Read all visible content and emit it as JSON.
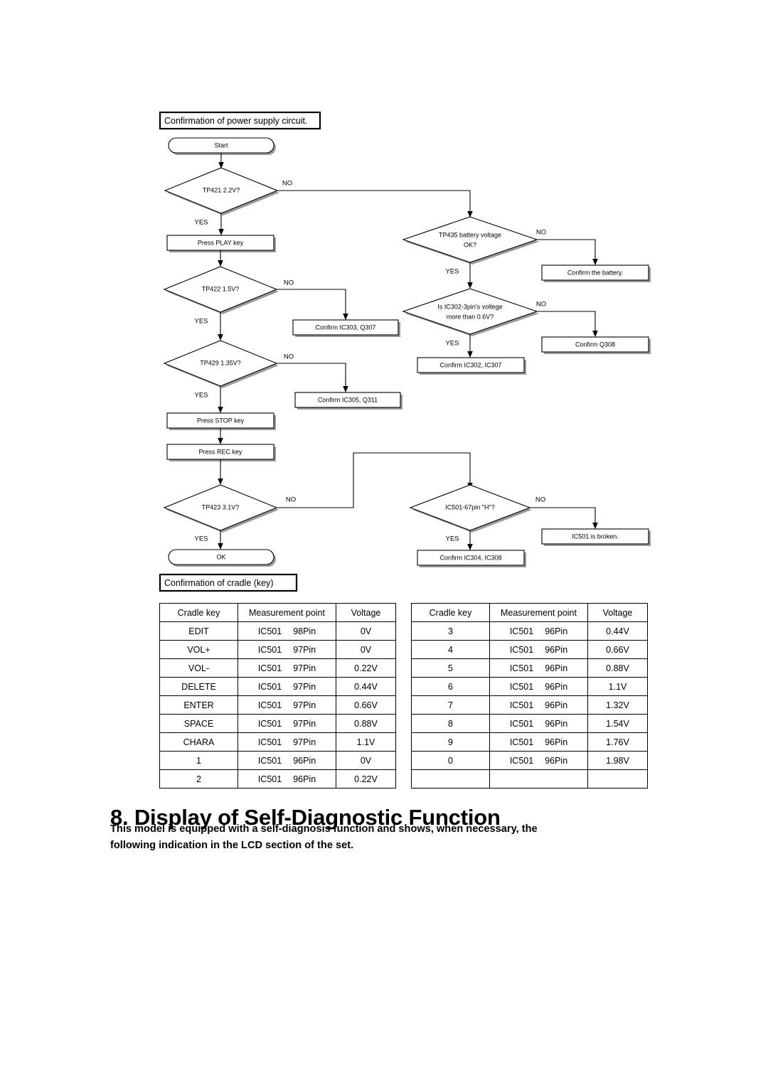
{
  "page": {
    "background_color": "#ffffff",
    "ink_color": "#000000",
    "shadow_color": "#9a9a9a"
  },
  "flowchart": {
    "banner_top": "Confirmation of power supply circuit.",
    "banner_bottom": "Confirmation of cradle (key)",
    "terminals": {
      "start": "Start",
      "ok": "OK"
    },
    "decisions": {
      "tp421": "TP421 2.2V?",
      "tp422": "TP422 1.5V?",
      "tp429": "TP429 1.35V?",
      "tp423": "TP423 3.1V?",
      "tp435_line1": "TP435 battery voltage",
      "tp435_line2": "OK?",
      "ic302_line1": "Is IC302-3pin's voltege",
      "ic302_line2": "more than 0.6V?",
      "ic501_67pin": "IC501-67pin \"H\"?"
    },
    "processes": {
      "press_play": "Press PLAY key",
      "press_stop": "Press STOP key",
      "press_rec": "Press REC key",
      "confirm_ic303_q307": "Confirm IC303, Q307",
      "confirm_ic305_q311": "Confirm IC305, Q311",
      "confirm_battery": "Confirm the battery.",
      "confirm_q308": "Confirm Q308",
      "confirm_ic302_ic307": "Confirm IC302, IC307",
      "confirm_ic304_ic308": "Confirm IC304, IC308",
      "ic501_broken": "IC501 is broken."
    },
    "branch_labels": {
      "yes": "YES",
      "no": "NO"
    }
  },
  "tables": {
    "headers": [
      "Cradle key",
      "Measurement point",
      "Voltage"
    ],
    "left_rows": [
      {
        "key": "EDIT",
        "ic": "IC501",
        "pin": "98Pin",
        "voltage": "0V"
      },
      {
        "key": "VOL+",
        "ic": "IC501",
        "pin": "97Pin",
        "voltage": "0V"
      },
      {
        "key": "VOL-",
        "ic": "IC501",
        "pin": "97Pin",
        "voltage": "0.22V"
      },
      {
        "key": "DELETE",
        "ic": "IC501",
        "pin": "97Pin",
        "voltage": "0.44V"
      },
      {
        "key": "ENTER",
        "ic": "IC501",
        "pin": "97Pin",
        "voltage": "0.66V"
      },
      {
        "key": "SPACE",
        "ic": "IC501",
        "pin": "97Pin",
        "voltage": "0.88V"
      },
      {
        "key": "CHARA",
        "ic": "IC501",
        "pin": "97Pin",
        "voltage": "1.1V"
      },
      {
        "key": "1",
        "ic": "IC501",
        "pin": "96Pin",
        "voltage": "0V"
      },
      {
        "key": "2",
        "ic": "IC501",
        "pin": "96Pin",
        "voltage": "0.22V"
      }
    ],
    "right_rows": [
      {
        "key": "3",
        "ic": "IC501",
        "pin": "96Pin",
        "voltage": "0.44V"
      },
      {
        "key": "4",
        "ic": "IC501",
        "pin": "96Pin",
        "voltage": "0.66V"
      },
      {
        "key": "5",
        "ic": "IC501",
        "pin": "96Pin",
        "voltage": "0.88V"
      },
      {
        "key": "6",
        "ic": "IC501",
        "pin": "96Pin",
        "voltage": "1.1V"
      },
      {
        "key": "7",
        "ic": "IC501",
        "pin": "96Pin",
        "voltage": "1.32V"
      },
      {
        "key": "8",
        "ic": "IC501",
        "pin": "96Pin",
        "voltage": "1.54V"
      },
      {
        "key": "9",
        "ic": "IC501",
        "pin": "96Pin",
        "voltage": "1.76V"
      },
      {
        "key": "0",
        "ic": "IC501",
        "pin": "96Pin",
        "voltage": "1.98V"
      },
      {
        "key": "",
        "ic": "",
        "pin": "",
        "voltage": ""
      }
    ]
  },
  "section": {
    "heading": "8. Display of Self-Diagnostic Function",
    "body_line1": "This model is equipped with a self-diagnosis function and shows, when necessary, the",
    "body_line2": "following indication in the LCD section of the set."
  }
}
